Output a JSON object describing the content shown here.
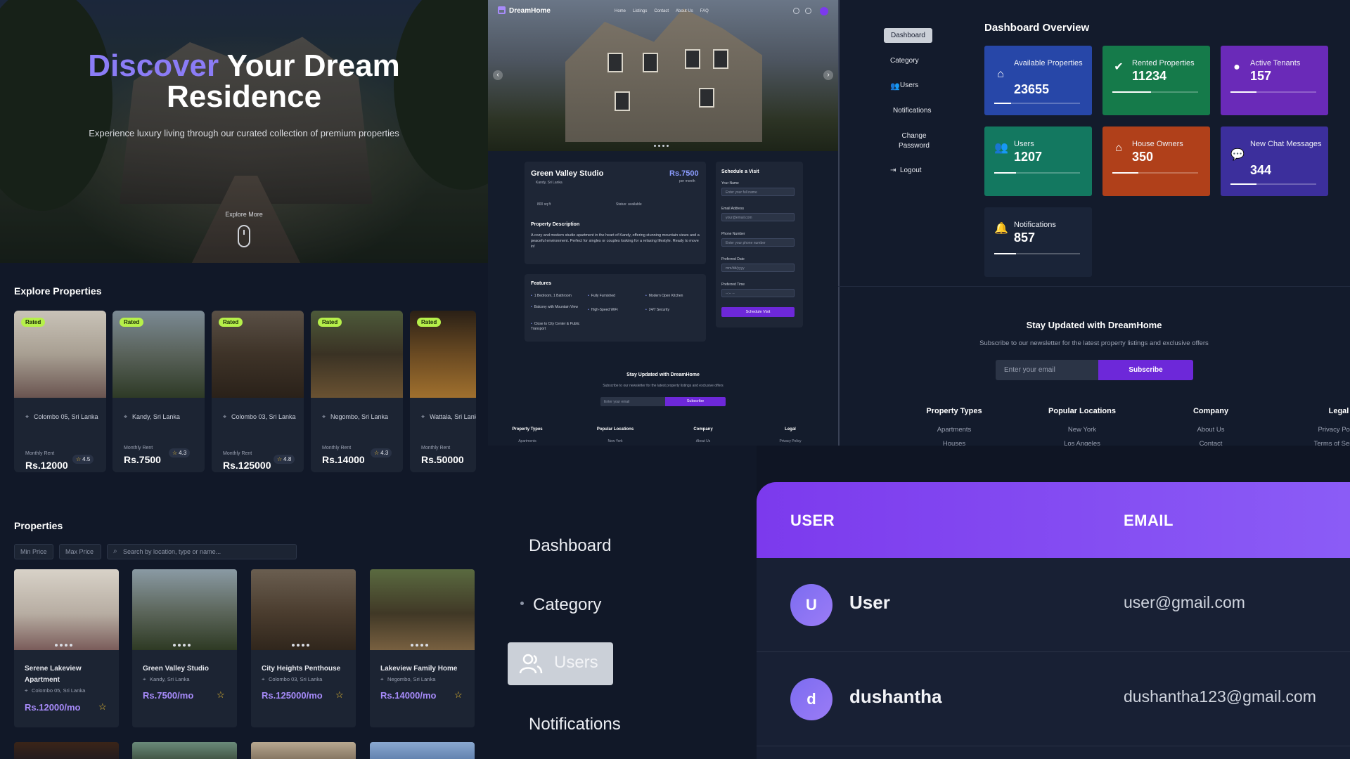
{
  "hero": {
    "title_accent": "Discover",
    "title_rest": "Your Dream",
    "title_line2": "Residence",
    "subtitle": "Experience luxury living through our curated collection of premium properties",
    "explore": "Explore More"
  },
  "detail": {
    "brand": "DreamHome",
    "nav": [
      "Home",
      "Listings",
      "Contact",
      "About Us",
      "FAQ"
    ],
    "prev": "‹",
    "next": "›",
    "title": "Green Valley Studio",
    "location": "Kandy, Sri Lanka",
    "price": "Rs.7500",
    "per": "per month",
    "area": "800 sq ft",
    "status": "Status: available",
    "desc_heading": "Property Description",
    "description": "A cozy and modern studio apartment in the heart of Kandy, offering stunning mountain views and a peaceful environment. Perfect for singles or couples looking for a relaxing lifestyle. Ready to move in!",
    "features_heading": "Features",
    "features": [
      "1 Bedroom, 1 Bathroom",
      "Fully Furnished",
      "Modern Open Kitchen",
      "Balcony with Mountain View",
      "High-Speed WiFi",
      "24/7 Security",
      "Close to City Center & Public Transport"
    ],
    "schedule": {
      "heading": "Schedule a Visit",
      "name_label": "Your Name",
      "name_ph": "Enter your full name",
      "email_label": "Email Address",
      "email_ph": "your@email.com",
      "phone_label": "Phone Number",
      "phone_ph": "Enter your phone number",
      "date_label": "Preferred Date",
      "date_ph": "mm/dd/yyyy",
      "time_label": "Preferred Time",
      "time_ph": "--:-- --",
      "button": "Schedule Visit"
    },
    "newsletter": {
      "title": "Stay Updated with DreamHome",
      "sub": "Subscribe to our newsletter for the latest property listings and exclusive offers",
      "placeholder": "Enter your email",
      "button": "Subscribe"
    },
    "footer": [
      {
        "h": "Property Types",
        "l": "Apartments"
      },
      {
        "h": "Popular Locations",
        "l": "New York"
      },
      {
        "h": "Company",
        "l": "About Us"
      },
      {
        "h": "Legal",
        "l": "Privacy Policy"
      }
    ]
  },
  "admin": {
    "sidebar": [
      "Dashboard",
      "Category",
      "Users",
      "Notifications",
      "Change Password",
      "Logout"
    ],
    "title": "Dashboard Overview",
    "stats": [
      {
        "label": "Available Properties",
        "value": "23655",
        "color": "#2747a8",
        "icon": "home-icon",
        "progress": 0.2
      },
      {
        "label": "Rented Properties",
        "value": "11234",
        "color": "#157a4a",
        "icon": "check-circle-icon",
        "progress": 0.45
      },
      {
        "label": "Active Tenants",
        "value": "157",
        "color": "#6a2ab8",
        "icon": "user-icon",
        "progress": 0.3
      },
      {
        "label": "Users",
        "value": "1207",
        "color": "#137860",
        "icon": "users-icon",
        "progress": 0.25
      },
      {
        "label": "House Owners",
        "value": "350",
        "color": "#b0401a",
        "icon": "home-icon",
        "progress": 0.3
      },
      {
        "label": "New Chat Messages",
        "value": "344",
        "color": "#3c2f9c",
        "icon": "chat-icon",
        "progress": 0.3
      },
      {
        "label": "Notifications",
        "value": "857",
        "color": "#1a2438",
        "icon": "bell-icon",
        "progress": 0.25
      }
    ],
    "newsletter": {
      "title": "Stay Updated with DreamHome",
      "sub": "Subscribe to our newsletter for the latest property listings and exclusive offers",
      "placeholder": "Enter your email",
      "button": "Subscribe"
    },
    "footer": [
      {
        "h": "Property Types",
        "l1": "Apartments",
        "l2": "Houses"
      },
      {
        "h": "Popular Locations",
        "l1": "New York",
        "l2": "Los Angeles"
      },
      {
        "h": "Company",
        "l1": "About Us",
        "l2": "Contact"
      },
      {
        "h": "Legal",
        "l1": "Privacy Policy",
        "l2": "Terms of Service"
      }
    ]
  },
  "explore": {
    "title": "Explore Properties",
    "cards": [
      {
        "badge": "Rated",
        "location": "Colombo 05, Sri Lanka",
        "monthly": "Monthly Rent",
        "price": "Rs.12000",
        "rating": "4.5"
      },
      {
        "badge": "Rated",
        "location": "Kandy, Sri Lanka",
        "monthly": "Monthly Rent",
        "price": "Rs.7500",
        "rating": "4.3"
      },
      {
        "badge": "Rated",
        "location": "Colombo 03, Sri Lanka",
        "monthly": "Monthly Rent",
        "price": "Rs.125000",
        "rating": "4.8"
      },
      {
        "badge": "Rated",
        "location": "Negombo, Sri Lanka",
        "monthly": "Monthly Rent",
        "price": "Rs.14000",
        "rating": "4.3"
      },
      {
        "badge": "Rated",
        "location": "Wattala, Sri Lanka",
        "monthly": "Monthly Rent",
        "price": "Rs.50000",
        "rating": ""
      }
    ]
  },
  "properties": {
    "title": "Properties",
    "min_price": "Min Price",
    "max_price": "Max Price",
    "search": "Search by location, type or name...",
    "cards": [
      {
        "name": "Serene Lakeview Apartment",
        "location": "Colombo 05, Sri Lanka",
        "price": "Rs.12000/mo"
      },
      {
        "name": "Green Valley Studio",
        "location": "Kandy, Sri Lanka",
        "price": "Rs.7500/mo"
      },
      {
        "name": "City Heights Penthouse",
        "location": "Colombo 03, Sri Lanka",
        "price": "Rs.125000/mo"
      },
      {
        "name": "Lakeview Family Home",
        "location": "Negombo, Sri Lanka",
        "price": "Rs.14000/mo"
      }
    ]
  },
  "sidezoom": {
    "items": [
      "Dashboard",
      "Category",
      "Users",
      "Notifications"
    ]
  },
  "users": {
    "col_user": "USER",
    "col_email": "EMAIL",
    "rows": [
      {
        "initial": "U",
        "name": "User",
        "email": "user@gmail.com"
      },
      {
        "initial": "d",
        "name": "dushantha",
        "email": "dushantha123@gmail.com"
      }
    ]
  }
}
